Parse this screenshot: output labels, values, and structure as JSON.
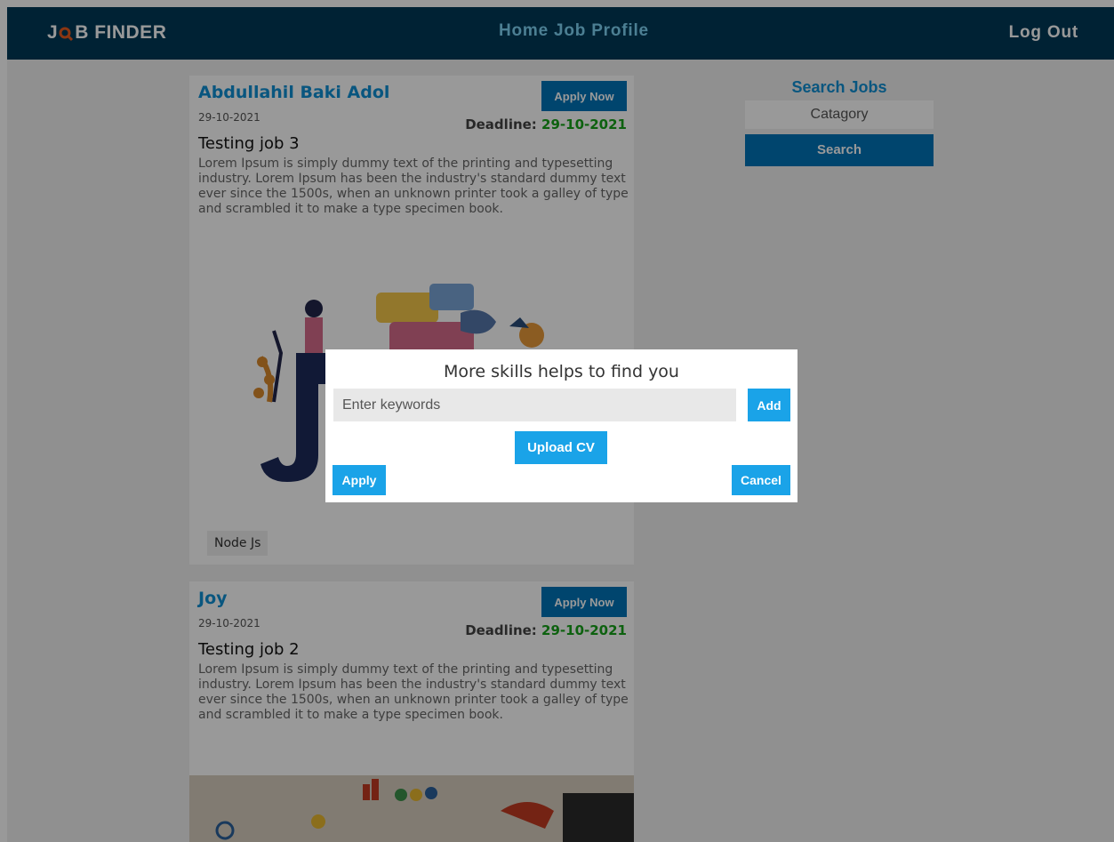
{
  "navbar": {
    "logo_left": "J",
    "logo_right": "B FINDER",
    "links": [
      "Home",
      "Job",
      "Profile"
    ],
    "logout": "Log Out"
  },
  "jobs": [
    {
      "poster": "Abdullahil Baki Adol",
      "apply_label": "Apply Now",
      "date": "29-10-2021",
      "deadline_label": "Deadline:",
      "deadline_value": "29-10-2021",
      "title": "Testing job 3",
      "description": "Lorem Ipsum is simply dummy text of the printing and typesetting industry. Lorem Ipsum has been the industry's standard dummy text ever since the 1500s, when an unknown printer took a galley of type and scrambled it to make a type specimen book.",
      "tag": "Node Js"
    },
    {
      "poster": "Joy",
      "apply_label": "Apply Now",
      "date": "29-10-2021",
      "deadline_label": "Deadline:",
      "deadline_value": "29-10-2021",
      "title": "Testing job 2",
      "description": "Lorem Ipsum is simply dummy text of the printing and typesetting industry. Lorem Ipsum has been the industry's standard dummy text ever since the 1500s, when an unknown printer took a galley of type and scrambled it to make a type specimen book."
    }
  ],
  "search": {
    "title": "Search Jobs",
    "category": "Catagory",
    "button": "Search"
  },
  "modal": {
    "title": "More skills helps to find you",
    "keywords_placeholder": "Enter keywords",
    "add": "Add",
    "upload": "Upload CV",
    "apply": "Apply",
    "cancel": "Cancel"
  },
  "colors": {
    "navbar": "#003a57",
    "accent": "#1aa3e8",
    "deadline": "#17a21a"
  }
}
